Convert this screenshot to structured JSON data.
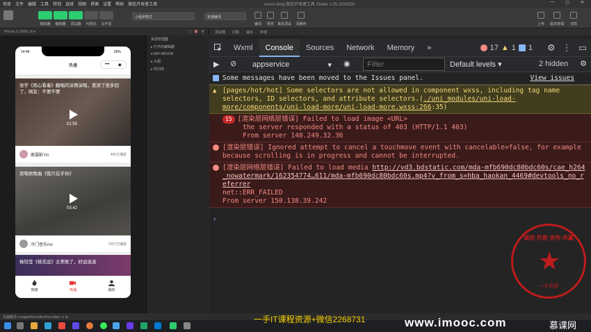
{
  "menubar": {
    "items": [
      "项目",
      "文件",
      "编辑",
      "工具",
      "转到",
      "选择",
      "视图",
      "界面",
      "设置",
      "帮助",
      "微信开发者工具"
    ],
    "title": "imooc-blog  微信开发者工具 Stable 1.05.2204250",
    "window_controls": [
      "—",
      "▢",
      "✕"
    ]
  },
  "toolbar": {
    "left_buttons": [
      {
        "label": "模拟器",
        "color": "#2ecc71"
      },
      {
        "label": "编辑器",
        "color": "#2ecc71"
      },
      {
        "label": "调试器",
        "color": "#2ecc71"
      },
      {
        "label": "可视化",
        "color": "#555555"
      },
      {
        "label": "云开发",
        "color": "#555555"
      }
    ],
    "mode_select": "小程序模式",
    "compile_select": "普通编译",
    "mid_buttons": [
      "编译",
      "预览",
      "真机调试",
      "清缓存"
    ],
    "right_buttons": [
      "上传",
      "版本管理",
      "详情"
    ]
  },
  "sim": {
    "device": "iPhone X 100% 16 ▾",
    "icons": [
      "▢",
      "🔇",
      "⚙"
    ]
  },
  "phone": {
    "time": "14:46",
    "battery": "60%",
    "nav_title": "热播",
    "capsule": [
      "•••",
      "◉"
    ],
    "cards": [
      {
        "title": "张宇《雨心看着》翻唱的深情演唱，爱哭了很多回了，网友：不要不要",
        "duration": "01:55",
        "author": "客服影Yin",
        "plays": "496万播放"
      },
      {
        "title": "双唱君歌曲《我只在乎你》",
        "duration": "03:42",
        "author": "冷门音乐mv",
        "plays": "2207万播放"
      },
      {
        "title": "杨钰莹《桃花运》太美歌了，好运连连",
        "duration": "",
        "author": "",
        "plays": ""
      }
    ],
    "tabs": [
      {
        "label": "热榜",
        "active": false
      },
      {
        "label": "热播",
        "active": true
      },
      {
        "label": "我的",
        "active": false
      }
    ]
  },
  "tree": {
    "title": "资源管理器",
    "items": [
      "▸ 打开的编辑器",
      "▾ IMP-WEIXIN",
      "  ▸ 大纲",
      "  ▸ 时间线"
    ]
  },
  "editor_tabs": [
    "调试器",
    "问题",
    "输出",
    "终端"
  ],
  "devtools": {
    "tabs": [
      "Wxml",
      "Console",
      "Sources",
      "Network",
      "Memory"
    ],
    "active_tab": "Console",
    "more": "»",
    "error_count": "17",
    "warning_count": "1",
    "info_count": "1",
    "context": "appservice",
    "filter_placeholder": "Filter",
    "levels": "Default levels ▾",
    "hidden": "2 hidden",
    "messages": [
      {
        "type": "info",
        "text": "Some messages have been moved to the Issues panel.",
        "link": "View issues"
      },
      {
        "type": "warn",
        "text": "[pages/hot/hot] Some selectors are not allowed in component wxss, including tag name selectors, ID selectors, and attribute selectors.(",
        "link": "./uni_modules/uni-load-more/components/uni-load-more/uni-load-more.wxss:266",
        "suffix": ":35)"
      },
      {
        "type": "err",
        "badge": "15",
        "lines": [
          "[渲染层网络层错误] Failed to load image <URL>",
          "the server responded with a status of 403 (HTTP/1.1 403)",
          "From server 140.249.32.36"
        ]
      },
      {
        "type": "err",
        "lines": [
          "[渲染层错误] Ignored attempt to cancel a touchmove event with cancelable=false, for example because scrolling is in progress and cannot be interrupted."
        ]
      },
      {
        "type": "err",
        "prefix": "[渲染层网络层错误] Failed to load media ",
        "link": "http://vd3.bdstatic.com/mda-mfb690dc80bdc60s/cae_h264_nowatermark/162354774…611/mda-mfb690dc80bdc60s.mp4?v_from_s=hba_haokan_4469#devtools_no_referrer",
        "lines": [
          "net::ERR_FAILED",
          "From server 150.138.39.242"
        ]
      }
    ],
    "prompt": "›"
  },
  "bottom_status": "页面路径 ▾  pages/hot-video/hot-video  ⊙ ⚙",
  "overlay": {
    "watermark": "一手IT课程资源+微信2268731",
    "imooc": "www.imooc.com",
    "brand": "慕课网",
    "stamp_top": "诚信·开放·合作·共赢",
    "stamp_bottom": "一手资源"
  },
  "colors": {
    "accent": "#8ab4f8",
    "error": "#f28b82",
    "warn": "#f5d87a",
    "green": "#2ecc71",
    "red_stamp": "#d81b1b"
  }
}
